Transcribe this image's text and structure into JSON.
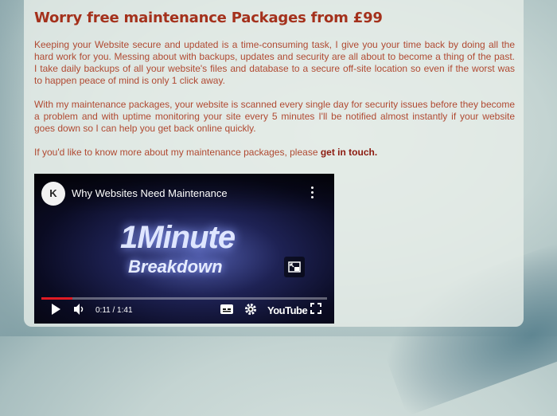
{
  "heading": "Worry free maintenance Packages from £99",
  "paragraphs": [
    "Keeping your Website secure and updated is a time-consuming task, I give you your time back by doing all the hard work for you. Messing about with backups, updates and security are all about to become a thing of the past. I take daily backups of all your website's files and database to a secure off-site location so even if the worst was to happen peace of mind is only 1 click away.",
    "With my maintenance packages, your website is scanned every single day for security issues before they become a problem and with uptime monitoring your site every 5 minutes I'll be notified almost instantly if your website goes down so I can help you get back online quickly."
  ],
  "contact": {
    "prefix": "If you'd like to know more about my maintenance packages, please ",
    "link": "get in touch."
  },
  "video": {
    "title": "Why Websites Need Maintenance",
    "channel_logo_text": "K",
    "overlay_line1": "1Minute",
    "overlay_line2": "Breakdown",
    "time": "0:11 / 1:41",
    "progress": 0.11,
    "youtube_label": "YouTube",
    "icons": [
      "play-icon",
      "volume-icon",
      "captions-icon",
      "settings-icon",
      "fullscreen-icon",
      "more-options-icon",
      "picture-in-picture-icon"
    ]
  },
  "colors": {
    "heading": "#a4311c",
    "body_text": "#b04a32",
    "link": "#8c1a0f",
    "progress": "#e01b24"
  }
}
